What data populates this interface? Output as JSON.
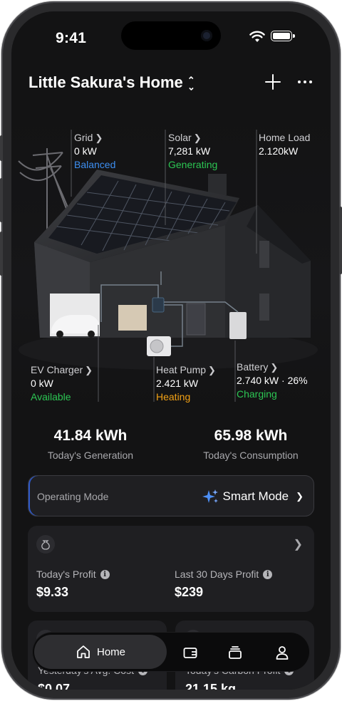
{
  "status_bar": {
    "time": "9:41"
  },
  "header": {
    "title": "Little Sakura's Home"
  },
  "flow": {
    "grid": {
      "label": "Grid",
      "value": "0 kW",
      "status": "Balanced"
    },
    "solar": {
      "label": "Solar",
      "value": "7,281 kW",
      "status": "Generating"
    },
    "home_load": {
      "label": "Home Load",
      "value": "2.120kW"
    },
    "ev_charger": {
      "label": "EV Charger",
      "value": "0 kW",
      "status": "Available"
    },
    "heat_pump": {
      "label": "Heat Pump",
      "value": "2.421 kW",
      "status": "Heating"
    },
    "battery": {
      "label": "Battery",
      "value": "2.740 kW · 26%",
      "status": "Charging"
    }
  },
  "stats": {
    "generation": {
      "value": "41.84 kWh",
      "label": "Today's Generation"
    },
    "consumption": {
      "value": "65.98 kWh",
      "label": "Today's Consumption"
    }
  },
  "mode": {
    "label": "Operating Mode",
    "value": "Smart Mode"
  },
  "profit": {
    "today": {
      "label": "Today's Profit",
      "value": "$9.33"
    },
    "last30": {
      "label": "Last 30 Days Profit",
      "value": "$239"
    }
  },
  "bottom_cards": {
    "avg_cost": {
      "label": "Yesterday's Avg. Cost",
      "value": "$0.07"
    },
    "carbon": {
      "label": "Today's Carbon Profit",
      "value": "21.15 kg"
    }
  },
  "tabs": {
    "home": "Home"
  },
  "colors": {
    "accent_blue": "#3d8ef0",
    "status_green": "#2cc653",
    "status_orange": "#f2a114",
    "background": "#131314"
  },
  "icons": [
    "wifi-icon",
    "battery-icon",
    "add-icon",
    "more-icon",
    "sparkle-icon",
    "coin-bag-icon",
    "info-icon",
    "home-icon",
    "wallet-icon",
    "devices-icon",
    "profile-icon"
  ]
}
